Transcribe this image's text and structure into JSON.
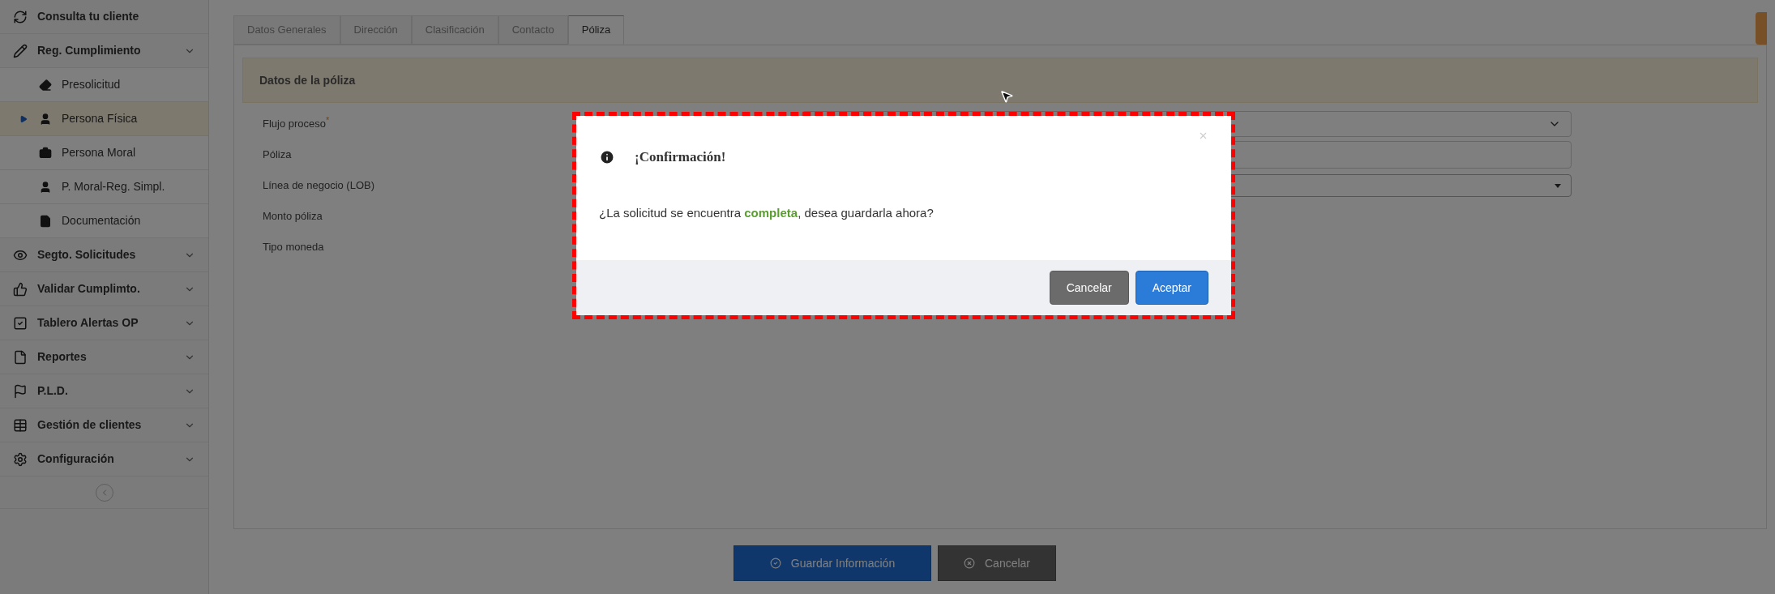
{
  "sidebar": {
    "items": [
      {
        "label": "Consulta tu cliente",
        "kind": "link"
      },
      {
        "label": "Reg. Cumplimiento",
        "kind": "menu",
        "children": [
          {
            "label": "Presolicitud",
            "selected": false
          },
          {
            "label": "Persona Física",
            "selected": true
          },
          {
            "label": "Persona Moral",
            "selected": false
          },
          {
            "label": "P. Moral-Reg. Simpl.",
            "selected": false
          },
          {
            "label": "Documentación",
            "selected": false
          }
        ]
      },
      {
        "label": "Segto. Solicitudes",
        "kind": "menu"
      },
      {
        "label": "Validar Cumplimto.",
        "kind": "menu"
      },
      {
        "label": "Tablero Alertas OP",
        "kind": "menu"
      },
      {
        "label": "Reportes",
        "kind": "menu"
      },
      {
        "label": "P.L.D.",
        "kind": "menu"
      },
      {
        "label": "Gestión de clientes",
        "kind": "menu"
      },
      {
        "label": "Configuración",
        "kind": "menu"
      }
    ]
  },
  "tabs": [
    {
      "label": "Datos Generales",
      "selected": false
    },
    {
      "label": "Dirección",
      "selected": false
    },
    {
      "label": "Clasificación",
      "selected": false
    },
    {
      "label": "Contacto",
      "selected": false
    },
    {
      "label": "Póliza",
      "selected": true
    }
  ],
  "form": {
    "section_title": "Datos de la póliza",
    "required_mark": "*",
    "fields": [
      {
        "label": "Flujo proceso",
        "required": true,
        "kind": "select"
      },
      {
        "label": "Póliza",
        "required": false,
        "kind": "text"
      },
      {
        "label": "Línea de negocio (LOB)",
        "required": false,
        "kind": "dropdown"
      },
      {
        "label": "Monto póliza",
        "required": false,
        "kind": "hidden"
      },
      {
        "label": "Tipo moneda",
        "required": false,
        "kind": "hidden"
      }
    ]
  },
  "footer_buttons": [
    {
      "label": "Guardar Información",
      "kind": "primary"
    },
    {
      "label": "Cancelar",
      "kind": "secondary"
    }
  ],
  "dialog": {
    "title": "¡Confirmación!",
    "message": "¿La solicitud se encuentra **completa**, desea guardarla ahora?",
    "buttons": [
      {
        "label": "Cancelar",
        "kind": "secondary"
      },
      {
        "label": "Aceptar",
        "kind": "primary"
      }
    ]
  }
}
